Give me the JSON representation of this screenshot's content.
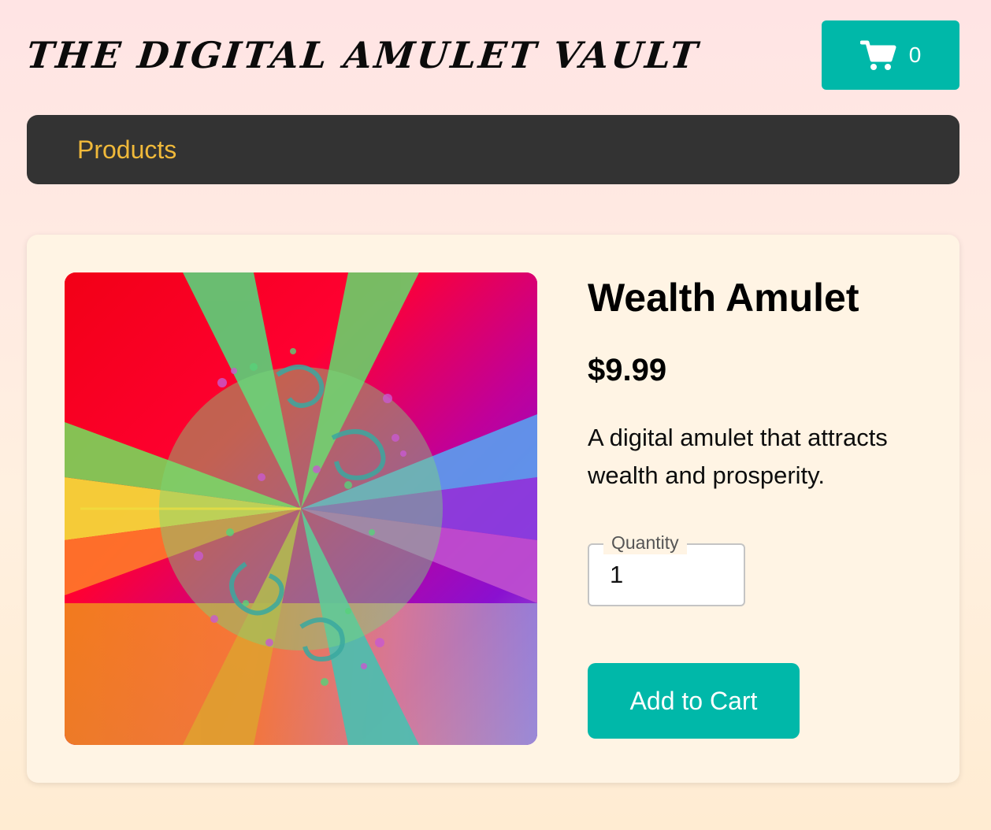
{
  "header": {
    "title": "The Digital Amulet Vault",
    "cart_count": "0",
    "cart_icon": "shopping-cart-icon"
  },
  "nav": {
    "items": [
      {
        "label": "Products"
      }
    ]
  },
  "product": {
    "name": "Wealth Amulet",
    "price": "$9.99",
    "description": "A digital amulet that attracts wealth and prosperity.",
    "quantity_label": "Quantity",
    "quantity_value": "1",
    "add_to_cart_label": "Add to Cart",
    "image_icon": "fractal-amulet-image"
  },
  "colors": {
    "accent": "#00b8a9",
    "nav_background": "#333333",
    "nav_link": "#f0b93a",
    "card_background": "#fff4e4"
  }
}
